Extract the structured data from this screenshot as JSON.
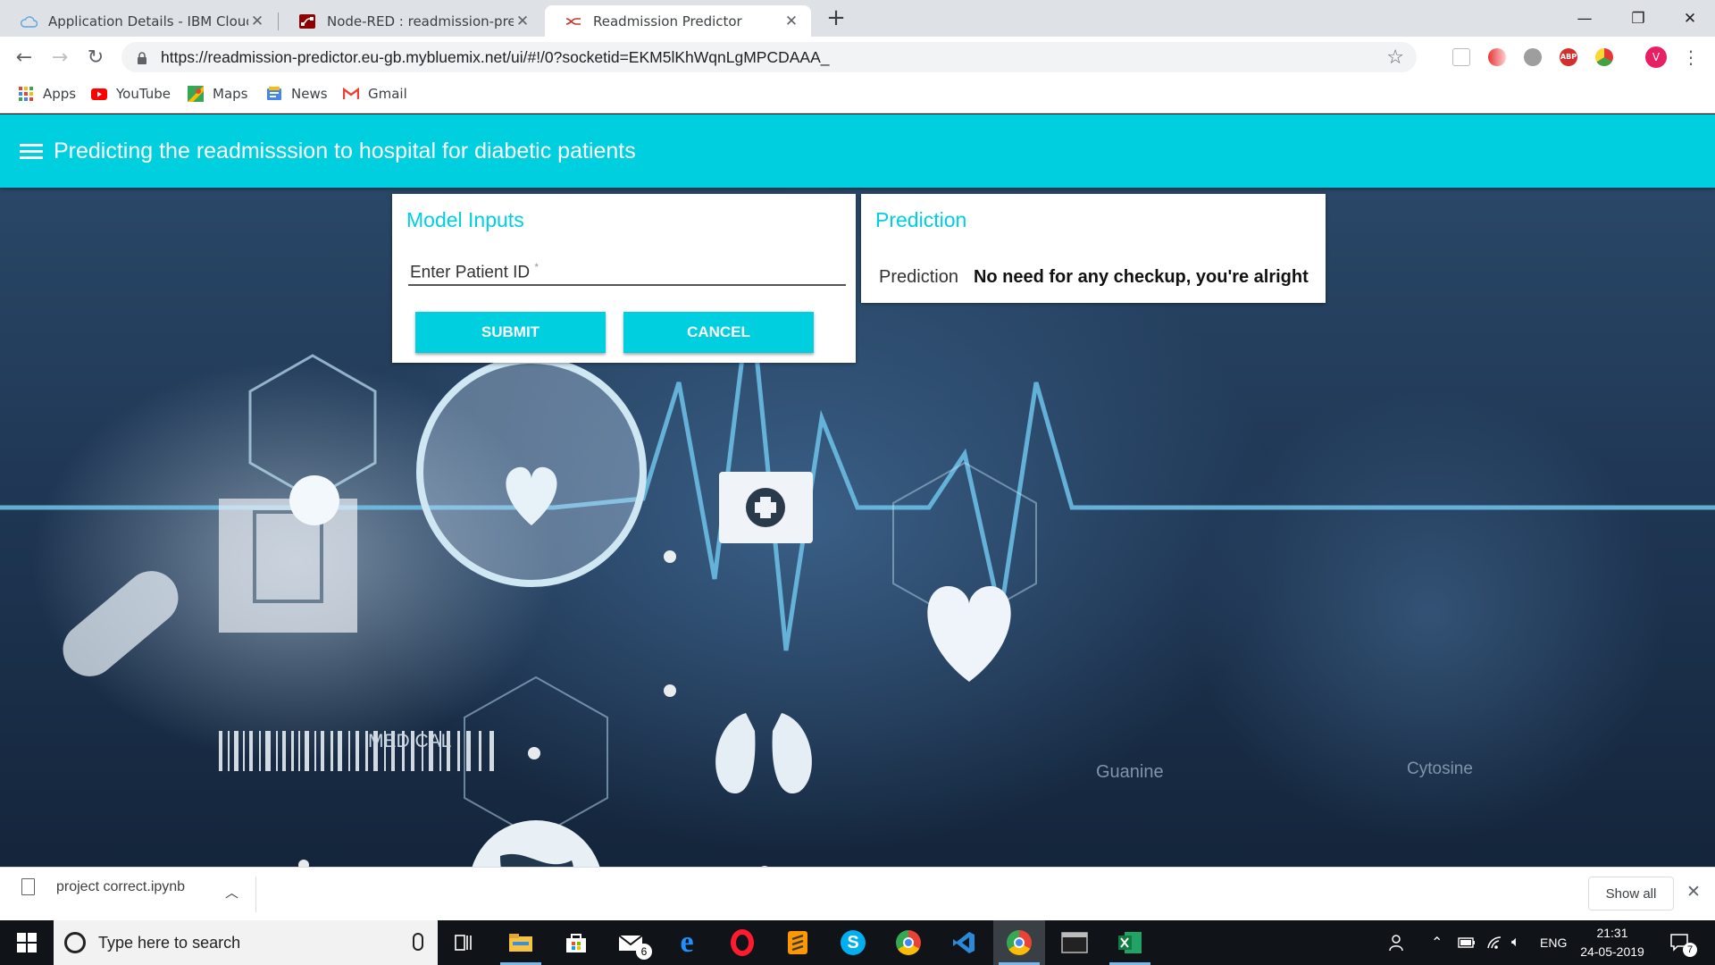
{
  "browser": {
    "tabs": [
      {
        "title": "Application Details - IBM Cloud",
        "active": false
      },
      {
        "title": "Node-RED : readmission-predictor",
        "active": false
      },
      {
        "title": "Readmission Predictor",
        "active": true
      }
    ],
    "url": "https://readmission-predictor.eu-gb.mybluemix.net/ui/#!/0?socketid=EKM5lKhWqnLgMPCDAAA_",
    "profile_initial": "V",
    "bookmarks": [
      "Apps",
      "YouTube",
      "Maps",
      "News",
      "Gmail"
    ]
  },
  "app": {
    "title": "Predicting the readmisssion to hospital for diabetic patients",
    "inputs_card": {
      "title": "Model Inputs",
      "field_label": "Enter Patient ID",
      "required_mark": "*",
      "submit_label": "SUBMIT",
      "cancel_label": "CANCEL"
    },
    "prediction_card": {
      "title": "Prediction",
      "label": "Prediction",
      "value": "No need for any checkup, you're alright"
    },
    "background_text": {
      "medical": "MEDICAL",
      "guanine": "Guanine",
      "cytosine": "Cytosine"
    }
  },
  "downloads": {
    "file_name": "project correct.ipynb",
    "show_all_label": "Show all"
  },
  "taskbar": {
    "search_placeholder": "Type here to search",
    "mail_badge": "6",
    "language": "ENG",
    "time": "21:31",
    "date": "24-05-2019",
    "notification_count": "7"
  },
  "colors": {
    "accent": "#00cfe0",
    "tab_strip": "#dee1e6"
  }
}
